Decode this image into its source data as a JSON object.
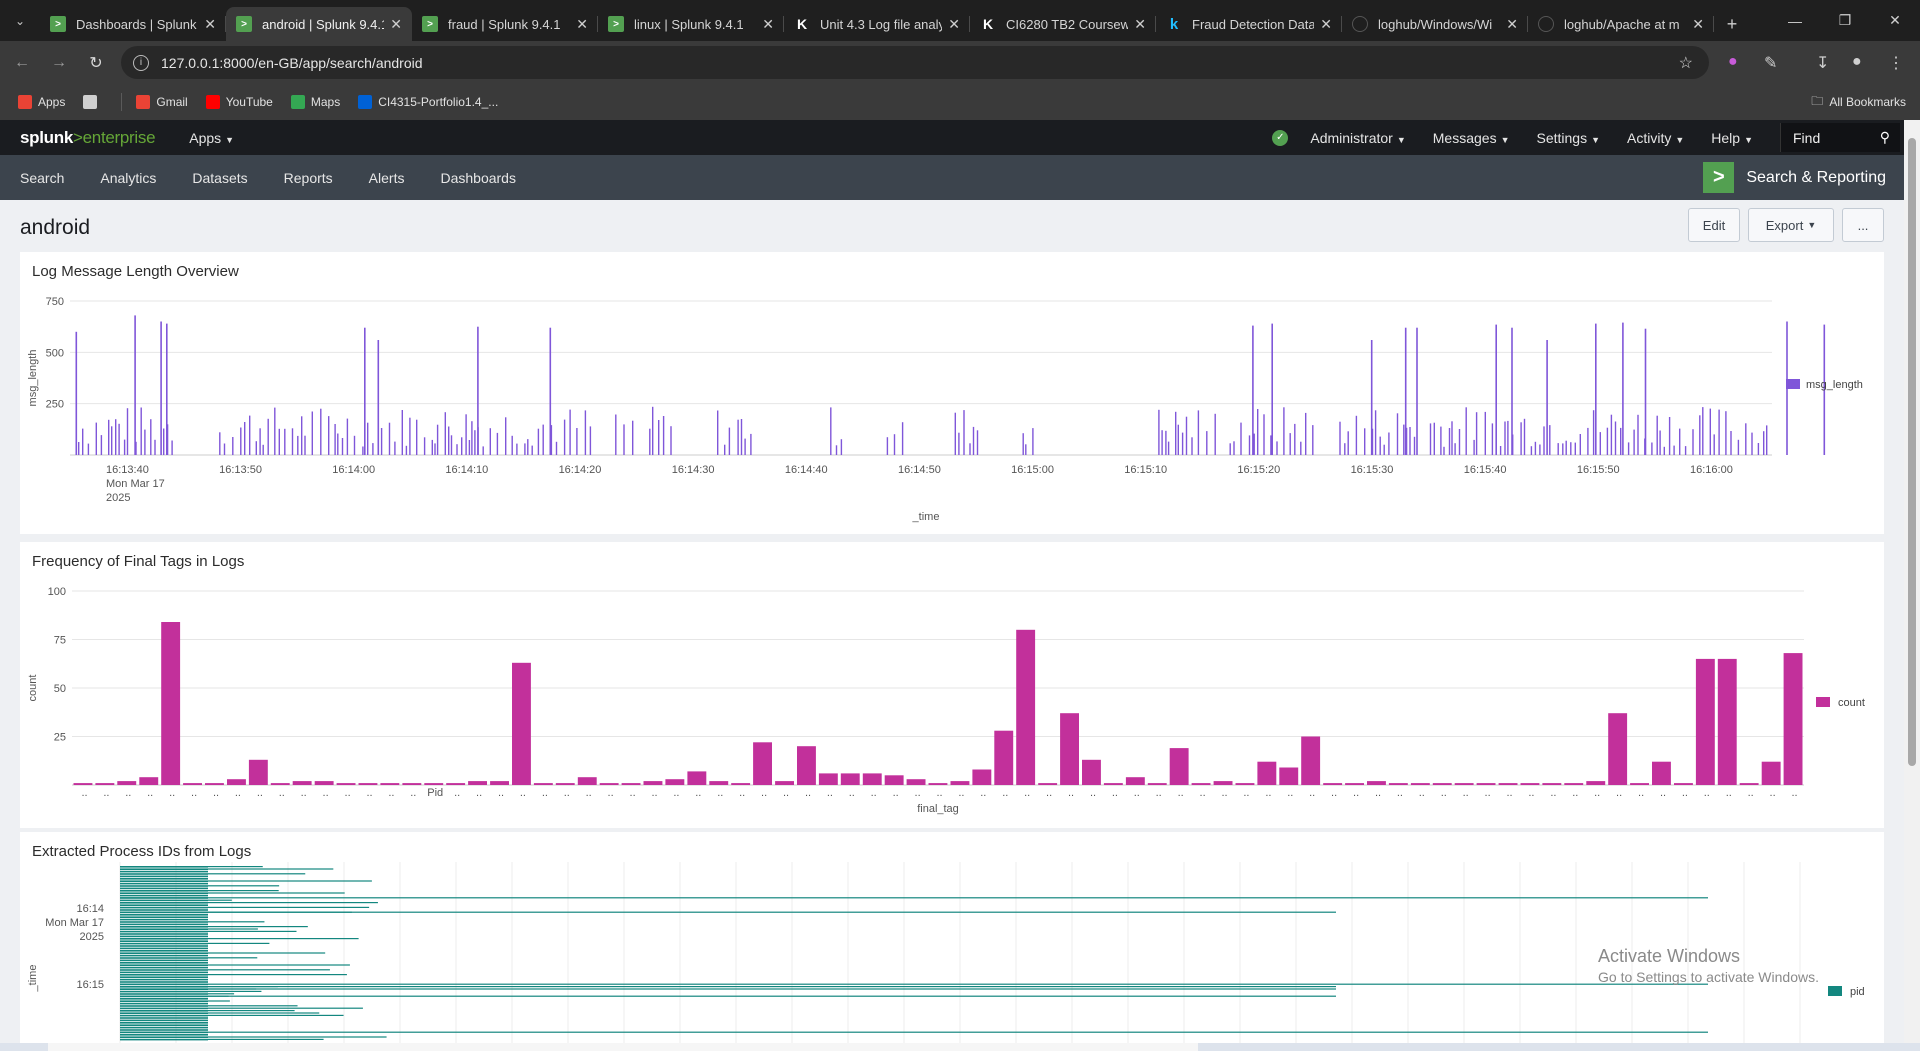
{
  "browser": {
    "tabs": [
      {
        "title": "Dashboards | Splunk",
        "icon": "splunk",
        "active": false
      },
      {
        "title": "android | Splunk 9.4.1",
        "icon": "splunk",
        "active": true
      },
      {
        "title": "fraud | Splunk 9.4.1",
        "icon": "splunk",
        "active": false
      },
      {
        "title": "linux | Splunk 9.4.1",
        "icon": "splunk",
        "active": false
      },
      {
        "title": "Unit 4.3 Log file analy",
        "icon": "kaggle-k",
        "active": false
      },
      {
        "title": "CI6280 TB2 Coursew",
        "icon": "kaggle-k",
        "active": false
      },
      {
        "title": "Fraud Detection Data",
        "icon": "kaggle-blue",
        "active": false
      },
      {
        "title": "loghub/Windows/Wi",
        "icon": "github",
        "active": false
      },
      {
        "title": "loghub/Apache at m",
        "icon": "github",
        "active": false
      }
    ],
    "url": "127.0.0.1:8000/en-GB/app/search/android",
    "bookmarks": [
      {
        "label": "Apps",
        "icon": "apps-grid",
        "color": "#ea4335"
      },
      {
        "label": "",
        "icon": "grid",
        "color": "#cfcfcf"
      },
      {
        "label": "Gmail",
        "icon": "gmail",
        "color": "#ea4335"
      },
      {
        "label": "YouTube",
        "icon": "youtube",
        "color": "#ff0000"
      },
      {
        "label": "Maps",
        "icon": "maps",
        "color": "#34a853"
      },
      {
        "label": "CI4315-Portfolio1.4_...",
        "icon": "box",
        "color": "#0061d5"
      }
    ],
    "all_bookmarks": "All Bookmarks"
  },
  "splunk": {
    "logo": {
      "brand": "splunk",
      "gt": ">",
      "product": "enterprise"
    },
    "apps_menu": "Apps",
    "top_menus": [
      "Administrator",
      "Messages",
      "Settings",
      "Activity",
      "Help"
    ],
    "find_placeholder": "Find",
    "nav": [
      "Search",
      "Analytics",
      "Datasets",
      "Reports",
      "Alerts",
      "Dashboards"
    ],
    "app_name": "Search & Reporting",
    "dashboard_title": "android",
    "buttons": {
      "edit": "Edit",
      "export": "Export",
      "more": "..."
    },
    "accent": "#53a051"
  },
  "panels": [
    {
      "title": "Log Message Length Overview"
    },
    {
      "title": "Frequency of Final Tags in Logs"
    },
    {
      "title": "Extracted Process IDs from Logs"
    }
  ],
  "chart_data": [
    {
      "type": "bar",
      "title": "Log Message Length Overview",
      "xlabel": "_time",
      "ylabel": "msg_length",
      "ylim": [
        0,
        750
      ],
      "yticks": [
        250,
        500,
        750
      ],
      "xticks": [
        "16:13:40",
        "16:13:50",
        "16:14:00",
        "16:14:10",
        "16:14:20",
        "16:14:30",
        "16:14:40",
        "16:14:50",
        "16:15:00",
        "16:15:10",
        "16:15:20",
        "16:15:30",
        "16:15:40",
        "16:15:50",
        "16:16:00"
      ],
      "xtick_date": [
        "Mon Mar 17",
        "2025"
      ],
      "color": "#7f56d9",
      "series": [
        {
          "name": "msg_length",
          "spikes": [
            {
              "t": 0.3,
              "v": 600
            },
            {
              "t": 5.5,
              "v": 680
            },
            {
              "t": 7.8,
              "v": 650
            },
            {
              "t": 8.3,
              "v": 640
            },
            {
              "t": 25.8,
              "v": 620
            },
            {
              "t": 27.0,
              "v": 560
            },
            {
              "t": 35.8,
              "v": 625
            },
            {
              "t": 42.2,
              "v": 620
            },
            {
              "t": 104.3,
              "v": 630
            },
            {
              "t": 106.0,
              "v": 640
            },
            {
              "t": 114.8,
              "v": 560
            },
            {
              "t": 117.8,
              "v": 620
            },
            {
              "t": 118.8,
              "v": 620
            },
            {
              "t": 125.8,
              "v": 635
            },
            {
              "t": 127.2,
              "v": 620
            },
            {
              "t": 130.3,
              "v": 560
            },
            {
              "t": 134.6,
              "v": 640
            },
            {
              "t": 137.0,
              "v": 645
            },
            {
              "t": 139.0,
              "v": 615
            },
            {
              "t": 151.5,
              "v": 650
            },
            {
              "t": 154.8,
              "v": 635
            }
          ],
          "base_ranges": [
            [
              0,
              9
            ],
            [
              13,
              46
            ],
            [
              48,
              49.5
            ],
            [
              51,
              53
            ],
            [
              57,
              60
            ],
            [
              67,
              68
            ],
            [
              72,
              73.5
            ],
            [
              78,
              80
            ],
            [
              84,
              85
            ],
            [
              96,
              101
            ],
            [
              102.3,
              110
            ],
            [
              112,
              119
            ],
            [
              120,
              150
            ],
            [
              151,
              155
            ]
          ]
        }
      ]
    },
    {
      "type": "bar",
      "title": "Frequency of Final Tags in Logs",
      "xlabel": "final_tag",
      "ylabel": "count",
      "ylim": [
        0,
        100
      ],
      "yticks": [
        25,
        50,
        75,
        100
      ],
      "color": "#c2309b",
      "series": [
        {
          "name": "count",
          "values": [
            1,
            1,
            2,
            4,
            84,
            1,
            1,
            3,
            13,
            1,
            2,
            2,
            1,
            1,
            1,
            1,
            1,
            1,
            2,
            2,
            63,
            1,
            1,
            4,
            1,
            1,
            2,
            3,
            7,
            2,
            1,
            22,
            2,
            20,
            6,
            6,
            6,
            5,
            3,
            1,
            2,
            8,
            28,
            80,
            1,
            37,
            13,
            1,
            4,
            1,
            19,
            1,
            2,
            1,
            12,
            9,
            25,
            1,
            1,
            2,
            1,
            1,
            1,
            1,
            1,
            1,
            1,
            1,
            1,
            2,
            37,
            1,
            12,
            1,
            65,
            65,
            1,
            12,
            68
          ]
        }
      ],
      "tick_labels_visible": [
        "Pid"
      ]
    },
    {
      "type": "bar",
      "title": "Extracted Process IDs from Logs",
      "xlabel": "",
      "ylabel": "_time",
      "yticks": [
        "16:14",
        "16:15"
      ],
      "ytick_date": [
        "Mon Mar 17",
        "2025"
      ],
      "color": "#13877f",
      "orientation": "horizontal",
      "series": [
        {
          "name": "pid"
        }
      ]
    }
  ],
  "watermark": {
    "line1": "Activate Windows",
    "line2": "Go to Settings to activate Windows."
  }
}
